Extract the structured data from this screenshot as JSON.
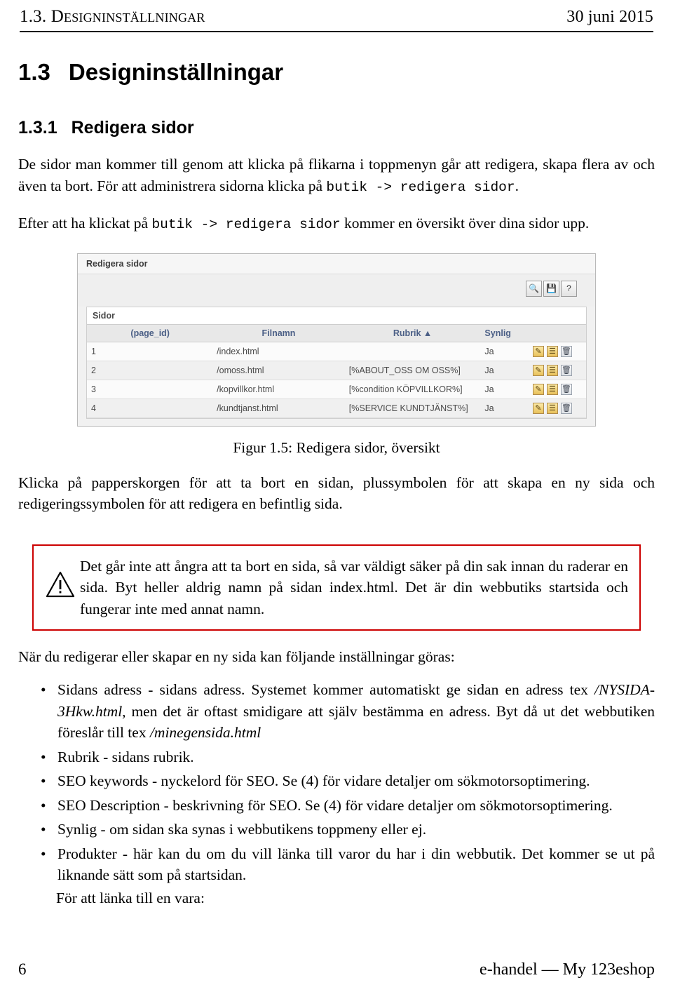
{
  "header": {
    "left": "1.3. Designinställningar",
    "right": "30 juni 2015"
  },
  "section": {
    "number": "1.3",
    "title": "Designinställningar"
  },
  "subsection": {
    "number": "1.3.1",
    "title": "Redigera sidor"
  },
  "paragraphs": {
    "p1_a": "De sidor man kommer till genom att klicka på flikarna i toppmenyn går att redigera, skapa flera av och även ta bort. För att administrera sidorna klicka på ",
    "p1_code": "butik -> redigera sidor",
    "p1_b": ".",
    "p2_a": "Efter att ha klickat på ",
    "p2_code": "butik -> redigera sidor",
    "p2_b": " kommer en översikt över dina sidor upp.",
    "p3": "Klicka på papperskorgen för att ta bort en sidan, plussymbolen för att skapa en ny sida och redigeringssymbolen för att redigera en befintlig sida.",
    "p4": "När du redigerar eller skapar en ny sida kan följande inställningar göras:"
  },
  "figure": {
    "caption": "Figur 1.5: Redigera sidor, översikt",
    "window_title": "Redigera sidor",
    "panel_label": "Sidor",
    "toolbar_icons": [
      "search-icon",
      "save-icon",
      "help-icon"
    ],
    "toolbar_glyphs": [
      "🔍",
      "💾",
      "?"
    ],
    "columns": [
      "",
      "(page_id)",
      "Filnamn",
      "Rubrik ▲",
      "Synlig",
      ""
    ],
    "rows": [
      {
        "id": "1",
        "page_id": "",
        "filnamn": "/index.html",
        "rubrik": "",
        "synlig": "Ja"
      },
      {
        "id": "2",
        "page_id": "",
        "filnamn": "/omoss.html",
        "rubrik": "[%ABOUT_OSS OM OSS%]",
        "synlig": "Ja"
      },
      {
        "id": "3",
        "page_id": "",
        "filnamn": "/kopvillkor.html",
        "rubrik": "[%condition KÖPVILLKOR%]",
        "synlig": "Ja"
      },
      {
        "id": "4",
        "page_id": "",
        "filnamn": "/kundtjanst.html",
        "rubrik": "[%SERVICE KUNDTJÄNST%]",
        "synlig": "Ja"
      }
    ],
    "row_action_glyphs": [
      "✎",
      "☰",
      "🗑"
    ]
  },
  "warning": {
    "icon": "warning-triangle-icon",
    "text": "Det går inte att ångra att ta bort en sida, så var väldigt säker på din sak innan du raderar en sida. Byt heller aldrig namn på sidan index.html. Det är din webbutiks startsida och fungerar inte med annat namn."
  },
  "bullets": [
    {
      "parts": [
        {
          "t": "Sidans adress - sidans adress. Systemet kommer automatiskt ge sidan en adress tex ",
          "i": false
        },
        {
          "t": "/NYSIDA-3Hkw.html",
          "i": true
        },
        {
          "t": ", men det är oftast smidigare att själv bestämma en adress. Byt då ut det webbutiken föreslår till tex ",
          "i": false
        },
        {
          "t": "/minegensida.html",
          "i": true
        }
      ]
    },
    {
      "parts": [
        {
          "t": "Rubrik - sidans rubrik.",
          "i": false
        }
      ]
    },
    {
      "parts": [
        {
          "t": "SEO keywords - nyckelord för SEO. Se (4) för vidare detaljer om sökmotorsoptimering.",
          "i": false
        }
      ]
    },
    {
      "parts": [
        {
          "t": "SEO Description - beskrivning för SEO. Se (4) för vidare detaljer om sökmotorsoptimering.",
          "i": false
        }
      ]
    },
    {
      "parts": [
        {
          "t": "Synlig - om sidan ska synas i webbutikens toppmeny eller ej.",
          "i": false
        }
      ]
    },
    {
      "parts": [
        {
          "t": "Produkter - här kan du om du vill länka till varor du har i din webbutik. Det kommer se ut på liknande sätt som på startsidan.",
          "i": false
        }
      ]
    }
  ],
  "after_list": "För att länka till en vara:",
  "footer": {
    "page": "6",
    "right": "e-handel — My 123eshop"
  }
}
